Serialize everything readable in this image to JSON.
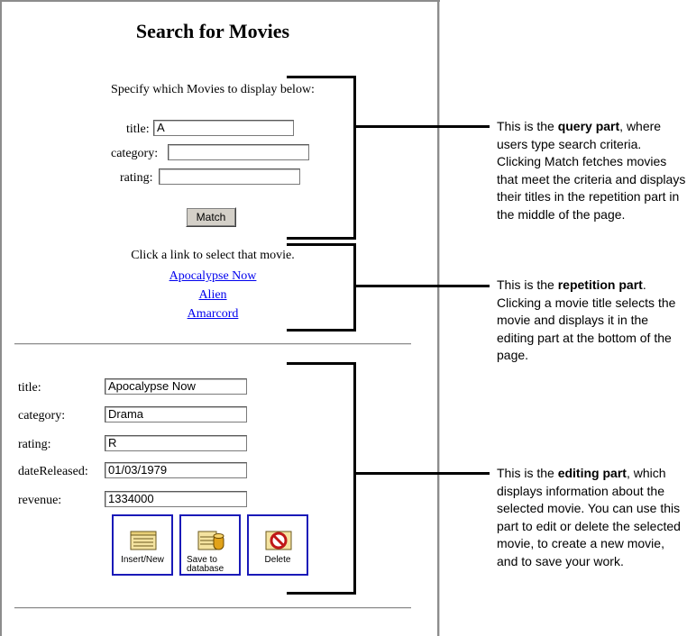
{
  "page": {
    "title": "Search for Movies"
  },
  "query": {
    "instruction": "Specify which Movies to display below:",
    "title_label": "title:",
    "title_value": "A",
    "category_label": "category:",
    "category_value": "",
    "rating_label": "rating:",
    "rating_value": "",
    "match_button": "Match"
  },
  "repetition": {
    "instruction": "Click a link to select that movie.",
    "movies": [
      "Apocalypse Now",
      "Alien",
      "Amarcord"
    ]
  },
  "editing": {
    "fields": [
      {
        "label": "title:",
        "value": "Apocalypse Now"
      },
      {
        "label": "category:",
        "value": "Drama"
      },
      {
        "label": "rating:",
        "value": "R"
      },
      {
        "label": "dateReleased:",
        "value": "01/03/1979"
      },
      {
        "label": "revenue:",
        "value": "1334000"
      }
    ],
    "buttons": [
      {
        "label_line1": "Insert/New",
        "label_line2": "",
        "icon": "insert-new-icon"
      },
      {
        "label_line1": "Save to",
        "label_line2": "database",
        "icon": "save-to-database-icon"
      },
      {
        "label_line1": "Delete",
        "label_line2": "",
        "icon": "delete-icon"
      }
    ]
  },
  "annotations": {
    "query": {
      "pre": "This is the ",
      "bold": "query part",
      "post": ", where users type search criteria. Clicking Match fetches movies that meet the criteria and displays their titles in the repetition part in the middle of the page."
    },
    "repetition": {
      "pre": "This is the ",
      "bold": "repetition part",
      "post": ". Clicking a movie title selects the movie and displays it in the editing part at the bottom of the page."
    },
    "editing": {
      "pre": "This is the ",
      "bold": "editing part",
      "post": ", which displays information about the selected movie. You can use this part to edit or delete the selected movie, to create a new movie, and to save your work."
    }
  },
  "colors": {
    "link": "#0000ee",
    "tool_border": "#1a1ab8",
    "button_face": "#d4d0c8"
  }
}
